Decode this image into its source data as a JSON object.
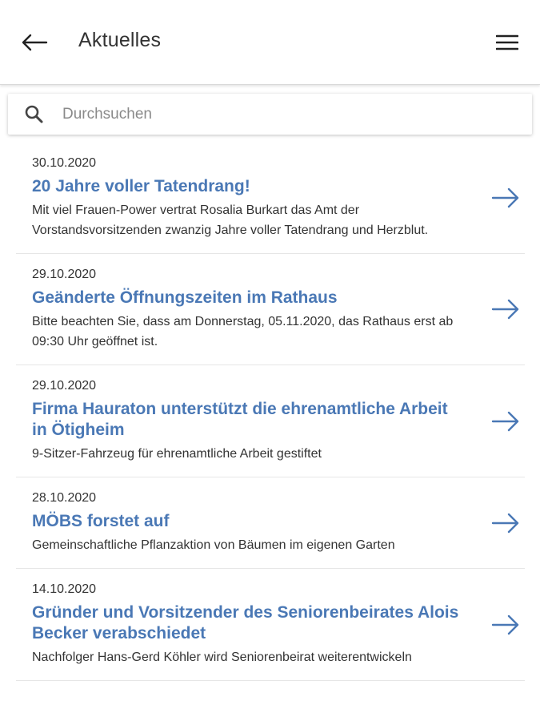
{
  "header": {
    "title": "Aktuelles",
    "back_icon": "arrow-left-icon",
    "menu_icon": "hamburger-menu-icon"
  },
  "search": {
    "placeholder": "Durchsuchen",
    "value": "",
    "icon": "search-icon"
  },
  "news": [
    {
      "date": "30.10.2020",
      "title": "20 Jahre voller Tatendrang!",
      "teaser": "Mit viel Frauen-Power vertrat Rosalia Burkart das Amt der Vorstandsvorsitzenden zwanzig Jahre voller Tatendrang und Herzblut."
    },
    {
      "date": "29.10.2020",
      "title": "Geänderte Öffnungszeiten im Rathaus",
      "teaser": "Bitte beachten Sie, dass am Donnerstag, 05.11.2020, das Rathaus erst ab 09:30 Uhr geöffnet ist."
    },
    {
      "date": "29.10.2020",
      "title": "Firma Hauraton unterstützt die ehrenamtliche Arbeit in Ötigheim",
      "teaser": "9-Sitzer-Fahrzeug für ehrenamtliche Arbeit gestiftet"
    },
    {
      "date": "28.10.2020",
      "title": "MÖBS forstet auf",
      "teaser": "Gemeinschaftliche Pflanzaktion von Bäumen im eigenen Garten"
    },
    {
      "date": "14.10.2020",
      "title": "Gründer und Vorsitzender des Seniorenbeirates Alois Becker verabschiedet",
      "teaser": "Nachfolger Hans-Gerd Köhler wird Seniorenbeirat weiterentwickeln"
    }
  ],
  "colors": {
    "accent": "#4a78b5",
    "text": "#333333",
    "divider": "#e6e6e6"
  }
}
